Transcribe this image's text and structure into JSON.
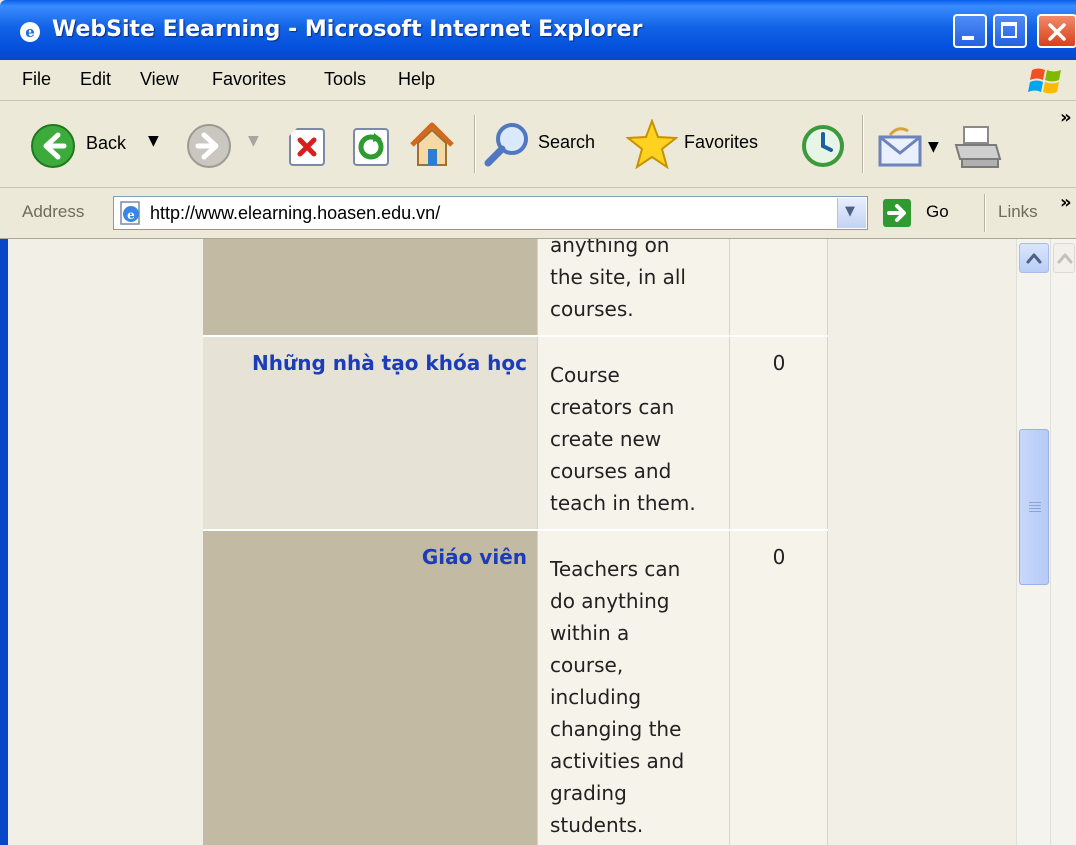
{
  "window": {
    "title": "WebSite Elearning - Microsoft Internet Explorer"
  },
  "menu": {
    "items": [
      "File",
      "Edit",
      "View",
      "Favorites",
      "Tools",
      "Help"
    ]
  },
  "toolbar": {
    "back_label": "Back",
    "search_label": "Search",
    "favorites_label": "Favorites"
  },
  "address": {
    "label": "Address",
    "url": "http://www.elearning.hoasen.edu.vn/",
    "go_label": "Go",
    "links_label": "Links"
  },
  "roles": [
    {
      "name": "",
      "description_lines": [
        "anything on",
        "the site, in all",
        "courses."
      ],
      "count": ""
    },
    {
      "name": "Những nhà tạo khóa học",
      "description_lines": [
        "Course",
        "creators can",
        "create new",
        "courses and",
        "teach in them."
      ],
      "count": "0"
    },
    {
      "name": "Giáo viên",
      "description_lines": [
        "Teachers can",
        "do anything",
        "within a",
        "course,",
        "including",
        "changing the",
        "activities and",
        "grading",
        "students."
      ],
      "count": "0"
    }
  ],
  "colors": {
    "title_bar": "#0a5fea",
    "role_link": "#1c3cb8",
    "row_dark": "#c3baa4",
    "row_light": "#e6e2d6"
  },
  "icons": {
    "back": "back-arrow-icon",
    "forward": "forward-arrow-icon",
    "stop": "stop-icon",
    "refresh": "refresh-icon",
    "home": "home-icon",
    "search": "search-icon",
    "favorites": "favorites-star-icon",
    "history": "history-icon",
    "mail": "mail-icon",
    "print": "print-icon"
  }
}
